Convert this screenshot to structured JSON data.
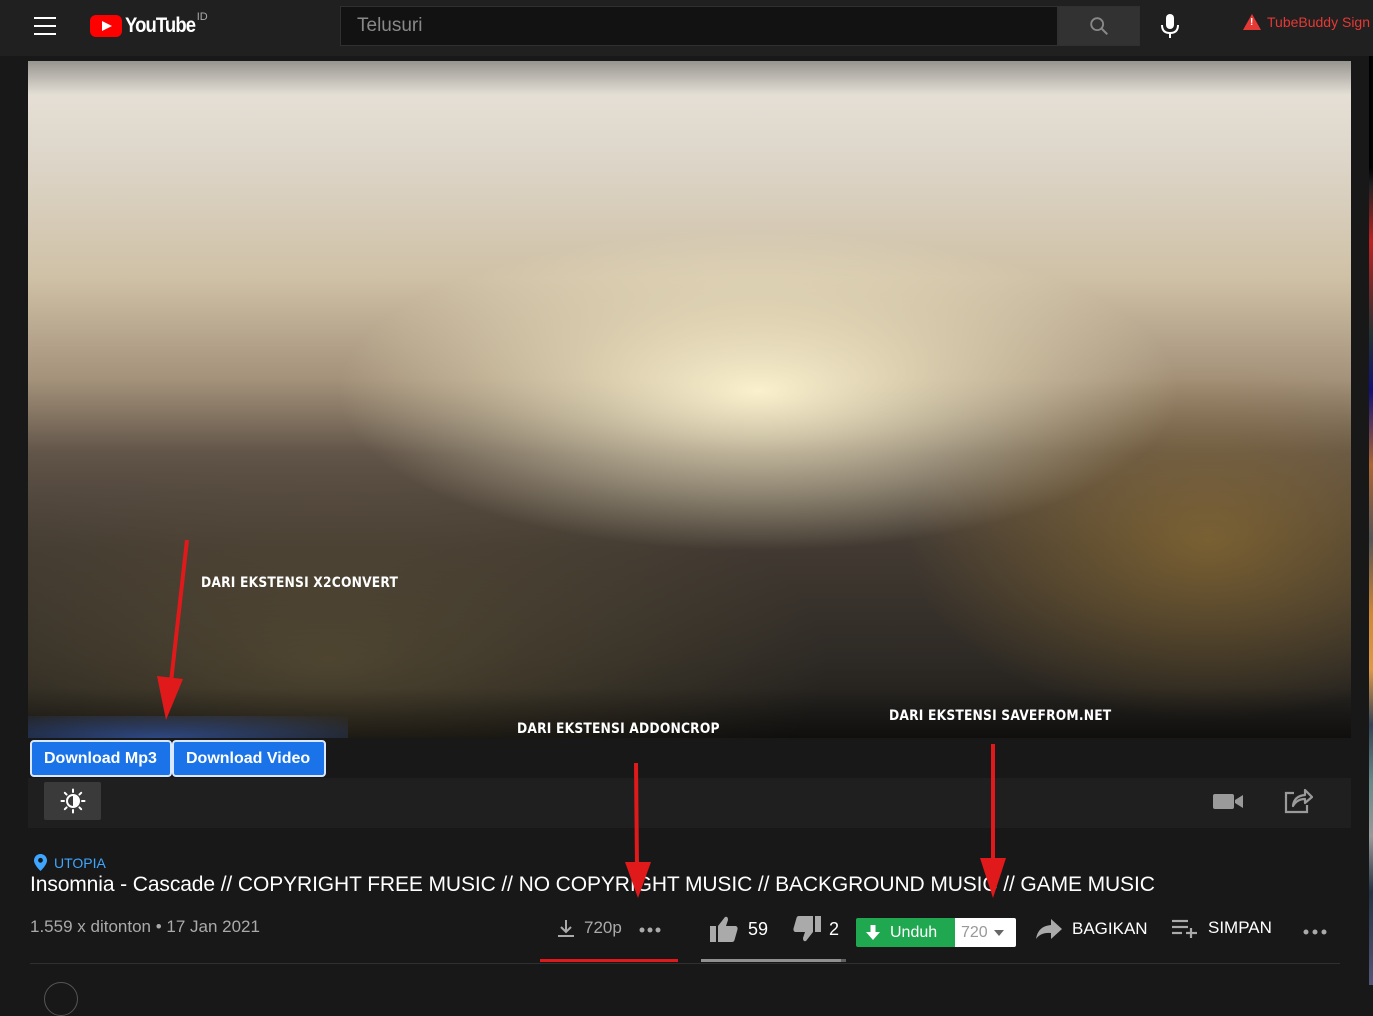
{
  "header": {
    "logo_text": "YouTube",
    "country_code": "ID",
    "search_placeholder": "Telusuri",
    "tubebuddy_label": "TubeBuddy Sign"
  },
  "annotations": {
    "x2convert": "DARI EKSTENSI X2CONVERT",
    "addoncrop": "DARI EKSTENSI ADDONCROP",
    "savefrom": "DARI EKSTENSI SAVEFROM.NET",
    "arrow_color": "#e01a1a"
  },
  "extension_buttons": {
    "download_mp3": "Download Mp3",
    "download_video": "Download Video"
  },
  "video": {
    "location": "UTOPIA",
    "title": "Insomnia - Cascade // COPYRIGHT FREE MUSIC // NO COPYRIGHT MUSIC // BACKGROUND MUSIC // GAME MUSIC",
    "meta": "1.559 x ditonton • 17 Jan 2021"
  },
  "actions": {
    "addon_quality": "720p",
    "likes": "59",
    "dislikes": "2",
    "like_ratio": 0.967,
    "unduh_label": "Unduh",
    "unduh_quality": "720",
    "share_label": "BAGIKAN",
    "save_label": "SIMPAN"
  },
  "colors": {
    "accent_blue": "#1a73e8",
    "unduh_green": "#1fa84f",
    "link_blue": "#3ea6ff",
    "warning_red": "#e53935"
  }
}
